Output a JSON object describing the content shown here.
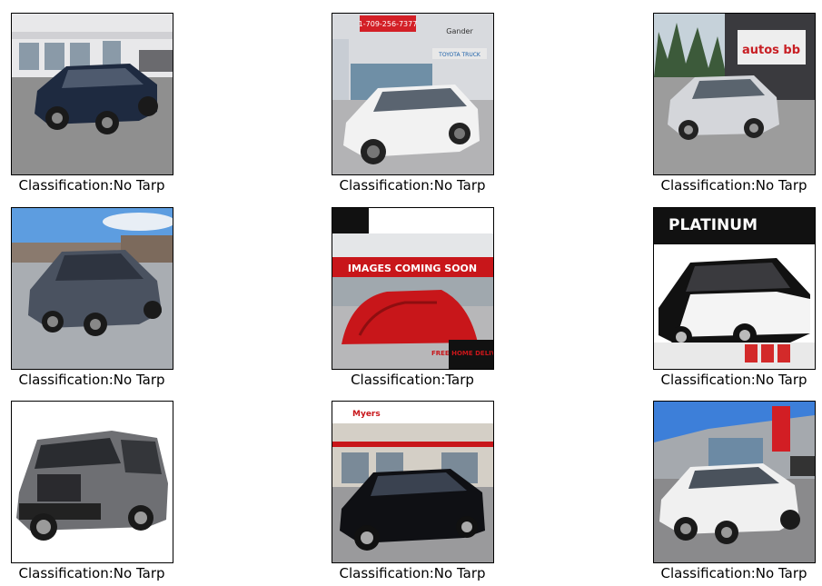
{
  "images": [
    {
      "caption": "Classification:No Tarp",
      "photo": "dark blue sedan in front of dealership"
    },
    {
      "caption": "Classification:No Tarp",
      "photo": "white sedan at toyota dealership",
      "sign_text": "1-709-256-7377",
      "dealer_text": "Gander",
      "banner_text": "TOYOTA TRUCK"
    },
    {
      "caption": "Classification:No Tarp",
      "photo": "silver hatchback in parking lot",
      "sign_text": "autos bb"
    },
    {
      "caption": "Classification:No Tarp",
      "photo": "grey sedan on street"
    },
    {
      "caption": "Classification:Tarp",
      "photo": "car covered with red tarp",
      "banner_text": "IMAGES COMING SOON",
      "corner_text": "FREE HOME DELIVERY"
    },
    {
      "caption": "Classification:No Tarp",
      "photo": "black and white luxury sedan",
      "sign_text": "PLATINUM"
    },
    {
      "caption": "Classification:No Tarp",
      "photo": "grey compact suv on white background"
    },
    {
      "caption": "Classification:No Tarp",
      "photo": "black sedan at dealership",
      "sign_text": "Myers"
    },
    {
      "caption": "Classification:No Tarp",
      "photo": "white sedan at dealership lot"
    }
  ],
  "colors": {
    "tarp": "#c8161a",
    "sky": "#5d9de0"
  }
}
